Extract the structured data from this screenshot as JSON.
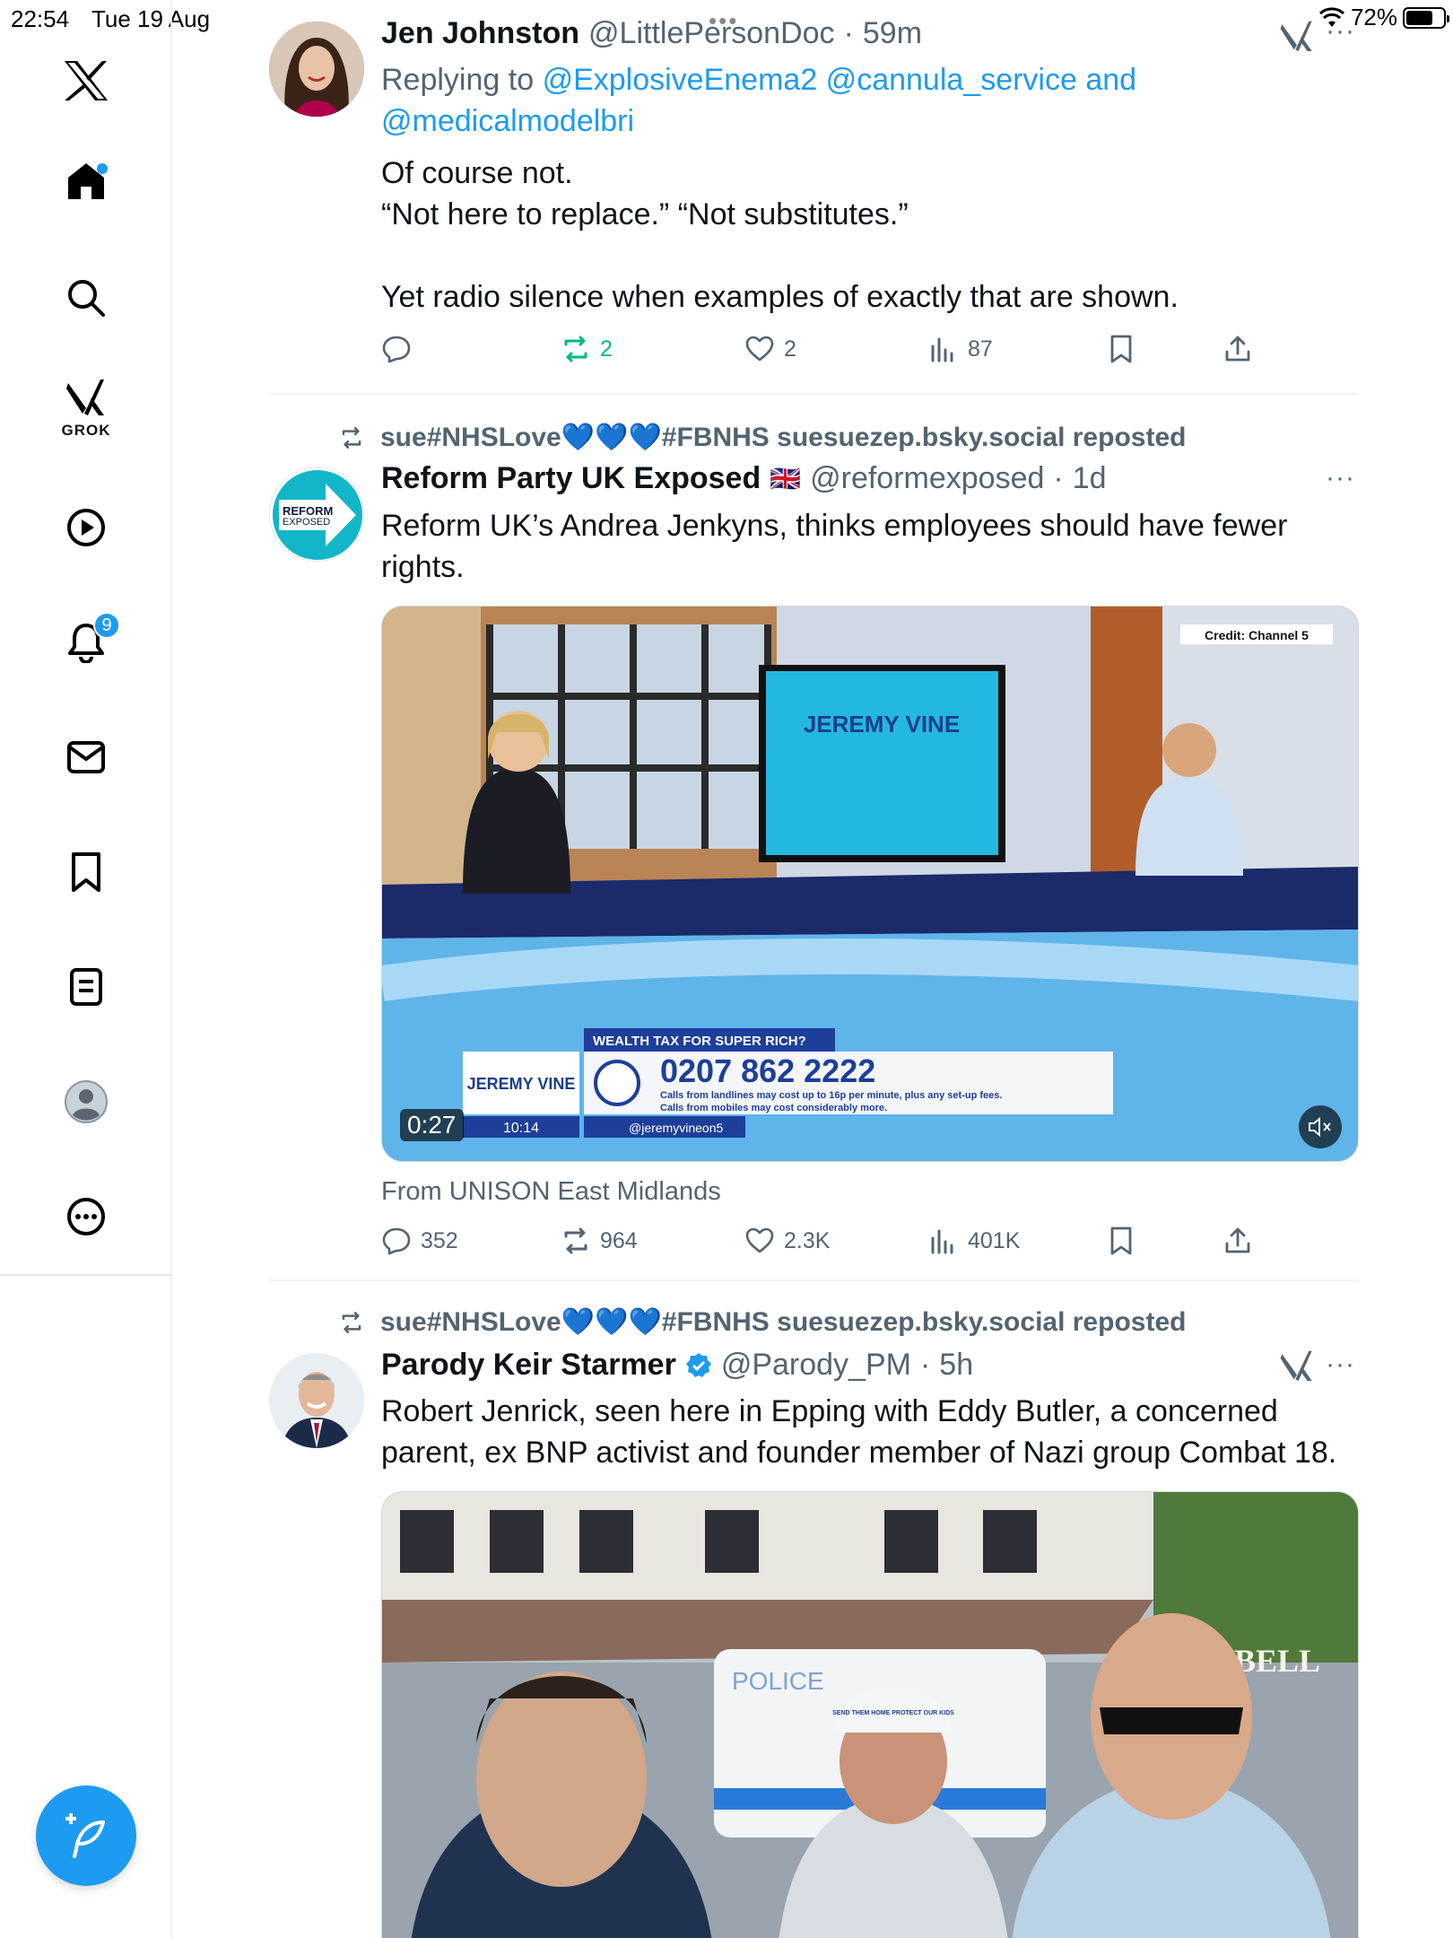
{
  "status_bar": {
    "time": "22:54",
    "date": "Tue 19 Aug",
    "battery": "72%",
    "battery_level": 0.72
  },
  "sidebar": {
    "grok_label": "GROK",
    "notifications_badge": "9"
  },
  "tweets": [
    {
      "name": "Jen Johnston",
      "handle": "@LittlePersonDoc",
      "time": "59m",
      "replying_prefix": "Replying to",
      "replying_handles": "@ExplosiveEnema2 @cannula_service",
      "replying_and": "and",
      "replying_last": "@medicalmodelbri",
      "text_lines": [
        "Of course not.",
        "“Not here to replace.” “Not substitutes.”",
        "",
        "Yet radio silence when examples of exactly that are shown."
      ],
      "replies": "",
      "reposts": "2",
      "likes": "2",
      "views": "87"
    },
    {
      "repost_text": "sue#NHSLove💙💙💙#FBNHS suesuezep.bsky.social reposted",
      "name": "Reform Party UK Exposed",
      "flag": "🇬🇧",
      "handle": "@reformexposed",
      "time": "1d",
      "avatar_text_1": "REFORM",
      "avatar_text_2": "EXPOSED",
      "text_lines": [
        "Reform UK’s Andrea Jenkyns, thinks employees should have fewer",
        "rights."
      ],
      "video": {
        "credit": "Credit: Channel 5",
        "screen_logo": "JEREMY VINE",
        "lower_title": "WEALTH TAX FOR SUPER RICH?",
        "phone": "0207 862 2222",
        "fine_print_1": "Calls from landlines may cost up to 16p per minute, plus any set-up fees.",
        "fine_print_2": "Calls from mobiles may cost considerably more.",
        "show_logo": "JEREMY VINE",
        "clock": "10:14",
        "social": "@jeremyvineon5",
        "duration": "0:27"
      },
      "from": "From UNISON East Midlands",
      "replies": "352",
      "reposts": "964",
      "likes": "2.3K",
      "views": "401K"
    },
    {
      "repost_text": "sue#NHSLove💙💙💙#FBNHS suesuezep.bsky.social reposted",
      "name": "Parody Keir Starmer",
      "handle": "@Parody_PM",
      "time": "5h",
      "text_lines": [
        "Robert Jenrick, seen here in Epping with Eddy Butler, a concerned",
        "parent, ex BNP activist and founder member of Nazi group Combat 18."
      ],
      "photo": {
        "van_text": "POLICE",
        "sign_text": "BELL",
        "cap_text": "SEND THEM HOME PROTECT OUR KIDS"
      }
    }
  ]
}
